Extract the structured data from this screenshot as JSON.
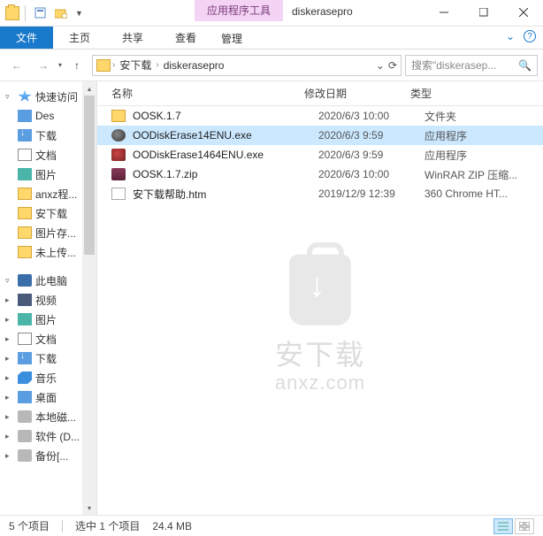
{
  "title": "diskerasepro",
  "context_tab": "应用程序工具",
  "ribbon": {
    "file": "文件",
    "tabs": [
      "主页",
      "共享",
      "查看"
    ],
    "ctx_tab": "管理"
  },
  "breadcrumb": {
    "items": [
      "安下载",
      "diskerasepro"
    ]
  },
  "search": {
    "placeholder": "搜索\"diskerasep..."
  },
  "sidebar": {
    "quick": "快速访问",
    "items": [
      {
        "label": "Des",
        "icon": "desk",
        "pin": true
      },
      {
        "label": "下载",
        "icon": "dl",
        "pin": true
      },
      {
        "label": "文档",
        "icon": "doc",
        "pin": true
      },
      {
        "label": "图片",
        "icon": "pic",
        "pin": true
      },
      {
        "label": "anxz程...",
        "icon": "folder"
      },
      {
        "label": "安下载",
        "icon": "folder"
      },
      {
        "label": "图片存...",
        "icon": "folder"
      },
      {
        "label": "未上传...",
        "icon": "folder"
      }
    ],
    "thispc": "此电脑",
    "pc_items": [
      {
        "label": "视频",
        "icon": "vid"
      },
      {
        "label": "图片",
        "icon": "pic"
      },
      {
        "label": "文档",
        "icon": "doc"
      },
      {
        "label": "下载",
        "icon": "dl"
      },
      {
        "label": "音乐",
        "icon": "mus"
      },
      {
        "label": "桌面",
        "icon": "desk"
      },
      {
        "label": "本地磁...",
        "icon": "disk"
      },
      {
        "label": "软件 (D...",
        "icon": "disk"
      },
      {
        "label": "备份[...",
        "icon": "disk"
      }
    ]
  },
  "columns": {
    "name": "名称",
    "date": "修改日期",
    "type": "类型"
  },
  "files": [
    {
      "name": "OOSK.1.7",
      "date": "2020/6/3 10:00",
      "type": "文件夹",
      "icon": "folder"
    },
    {
      "name": "OODiskErase14ENU.exe",
      "date": "2020/6/3 9:59",
      "type": "应用程序",
      "icon": "exe",
      "selected": true
    },
    {
      "name": "OODiskErase1464ENU.exe",
      "date": "2020/6/3 9:59",
      "type": "应用程序",
      "icon": "exe2"
    },
    {
      "name": "OOSK.1.7.zip",
      "date": "2020/6/3 10:00",
      "type": "WinRAR ZIP 压缩...",
      "icon": "zip"
    },
    {
      "name": "安下载帮助.htm",
      "date": "2019/12/9 12:39",
      "type": "360 Chrome HT...",
      "icon": "htm"
    }
  ],
  "watermark": {
    "line1": "安下载",
    "line2": "anxz.com"
  },
  "status": {
    "count": "5 个项目",
    "selected": "选中 1 个项目",
    "size": "24.4 MB"
  }
}
